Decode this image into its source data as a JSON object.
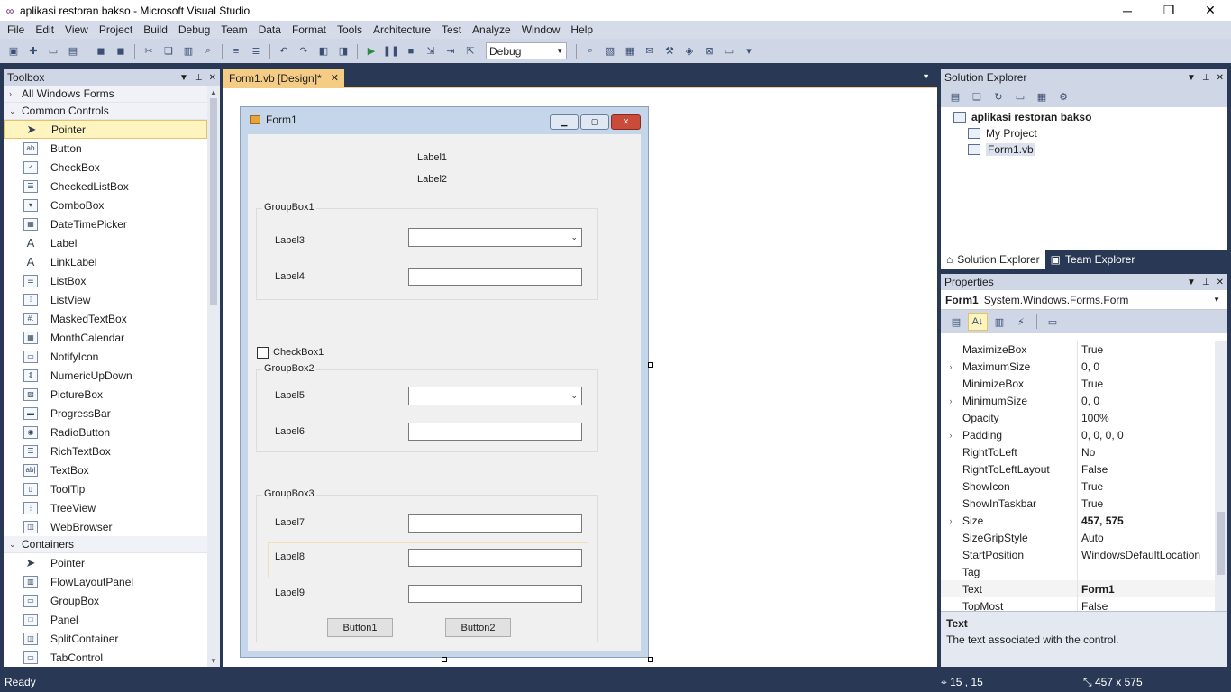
{
  "window": {
    "title": "aplikasi restoran bakso - Microsoft Visual Studio",
    "minimize": "─",
    "restore": "❐",
    "close": "✕"
  },
  "menu": [
    "File",
    "Edit",
    "View",
    "Project",
    "Build",
    "Debug",
    "Team",
    "Data",
    "Format",
    "Tools",
    "Architecture",
    "Test",
    "Analyze",
    "Window",
    "Help"
  ],
  "toolbar": {
    "config": "Debug"
  },
  "toolbox": {
    "title": "Toolbox",
    "categories": {
      "all": "All Windows Forms",
      "common": "Common Controls",
      "containers": "Containers"
    },
    "common_items": [
      "Pointer",
      "Button",
      "CheckBox",
      "CheckedListBox",
      "ComboBox",
      "DateTimePicker",
      "Label",
      "LinkLabel",
      "ListBox",
      "ListView",
      "MaskedTextBox",
      "MonthCalendar",
      "NotifyIcon",
      "NumericUpDown",
      "PictureBox",
      "ProgressBar",
      "RadioButton",
      "RichTextBox",
      "TextBox",
      "ToolTip",
      "TreeView",
      "WebBrowser"
    ],
    "container_items": [
      "Pointer",
      "FlowLayoutPanel",
      "GroupBox",
      "Panel",
      "SplitContainer",
      "TabControl"
    ]
  },
  "document": {
    "tab": "Form1.vb [Design]*"
  },
  "form": {
    "title": "Form1",
    "label1": "Label1",
    "label2": "Label2",
    "groupbox1": "GroupBox1",
    "label3": "Label3",
    "label4": "Label4",
    "checkbox1": "CheckBox1",
    "groupbox2": "GroupBox2",
    "label5": "Label5",
    "label6": "Label6",
    "groupbox3": "GroupBox3",
    "label7": "Label7",
    "label8": "Label8",
    "label9": "Label9",
    "button1": "Button1",
    "button2": "Button2"
  },
  "solution_explorer": {
    "title": "Solution Explorer",
    "project": "aplikasi restoran bakso",
    "my_project": "My Project",
    "form_file": "Form1.vb",
    "tab_solution": "Solution Explorer",
    "tab_team": "Team Explorer"
  },
  "properties": {
    "title": "Properties",
    "object_name": "Form1",
    "object_type": "System.Windows.Forms.Form",
    "rows": [
      {
        "name": "MaximizeBox",
        "value": "True",
        "expandable": false
      },
      {
        "name": "MaximumSize",
        "value": "0, 0",
        "expandable": true
      },
      {
        "name": "MinimizeBox",
        "value": "True",
        "expandable": false
      },
      {
        "name": "MinimumSize",
        "value": "0, 0",
        "expandable": true
      },
      {
        "name": "Opacity",
        "value": "100%",
        "expandable": false
      },
      {
        "name": "Padding",
        "value": "0, 0, 0, 0",
        "expandable": true
      },
      {
        "name": "RightToLeft",
        "value": "No",
        "expandable": false
      },
      {
        "name": "RightToLeftLayout",
        "value": "False",
        "expandable": false
      },
      {
        "name": "ShowIcon",
        "value": "True",
        "expandable": false
      },
      {
        "name": "ShowInTaskbar",
        "value": "True",
        "expandable": false
      },
      {
        "name": "Size",
        "value": "457, 575",
        "expandable": true
      },
      {
        "name": "SizeGripStyle",
        "value": "Auto",
        "expandable": false
      },
      {
        "name": "StartPosition",
        "value": "WindowsDefaultLocation",
        "expandable": false
      },
      {
        "name": "Tag",
        "value": "",
        "expandable": false
      },
      {
        "name": "Text",
        "value": "Form1",
        "expandable": false
      },
      {
        "name": "TopMost",
        "value": "False",
        "expandable": false
      }
    ],
    "desc_title": "Text",
    "desc_text": "The text associated with the control."
  },
  "status": {
    "text": "Ready",
    "position": "15 , 15",
    "size": "457 x 575"
  }
}
